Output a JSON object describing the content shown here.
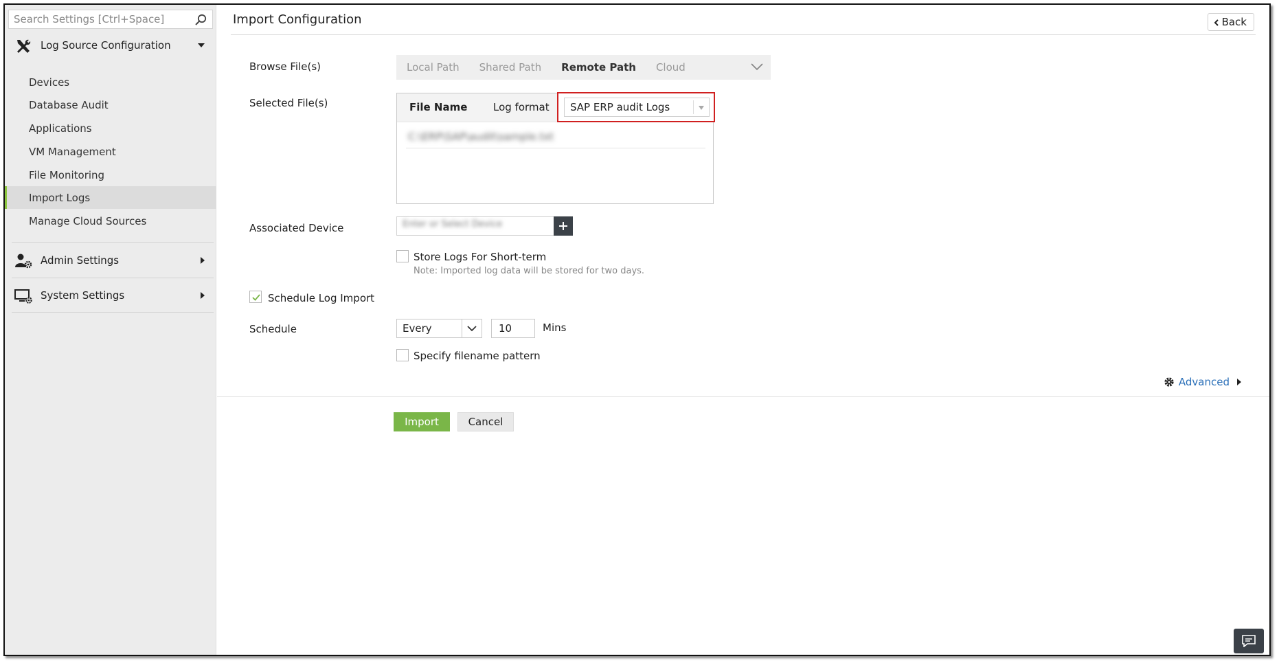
{
  "sidebar": {
    "search_placeholder": "Search Settings [Ctrl+Space]",
    "sections": [
      {
        "label": "Log Source Configuration",
        "icon": "tools-icon",
        "expanded": true
      },
      {
        "label": "Admin Settings",
        "icon": "user-gear-icon",
        "expanded": false
      },
      {
        "label": "System Settings",
        "icon": "monitor-gear-icon",
        "expanded": false
      }
    ],
    "items": [
      {
        "label": "Devices"
      },
      {
        "label": "Database Audit"
      },
      {
        "label": "Applications"
      },
      {
        "label": "VM Management"
      },
      {
        "label": "File Monitoring"
      },
      {
        "label": "Import Logs",
        "active": true
      },
      {
        "label": "Manage Cloud Sources"
      }
    ],
    "active_accent": "#8dc63f"
  },
  "main": {
    "title": "Import Configuration",
    "back_label": "Back",
    "browse": {
      "label": "Browse File(s)",
      "tabs": [
        "Local Path",
        "Shared Path",
        "Remote Path",
        "Cloud"
      ],
      "active_tab": "Remote Path"
    },
    "selected": {
      "label": "Selected File(s)",
      "col_file_name": "File Name",
      "col_log_format": "Log format",
      "log_format_value": "SAP ERP audit Logs",
      "file_row": "C:\\ERP\\SAP\\audit\\sample.txt"
    },
    "device": {
      "label": "Associated Device",
      "value": "Enter or Select Device"
    },
    "store_short_term": {
      "label": "Store Logs For Short-term",
      "checked": false,
      "note": "Note: Imported log data will be stored for two days."
    },
    "schedule_import": {
      "label": "Schedule Log Import",
      "checked": true
    },
    "schedule": {
      "label": "Schedule",
      "frequency": "Every",
      "value": "10",
      "unit": "Mins"
    },
    "filename_pattern": {
      "label": "Specify filename pattern",
      "checked": false
    },
    "advanced_label": "Advanced",
    "import_label": "Import",
    "cancel_label": "Cancel"
  },
  "colors": {
    "import_button": "#7ab648",
    "highlight_border": "#d02020",
    "link": "#2a6fb8",
    "dark_button": "#3b4148"
  }
}
